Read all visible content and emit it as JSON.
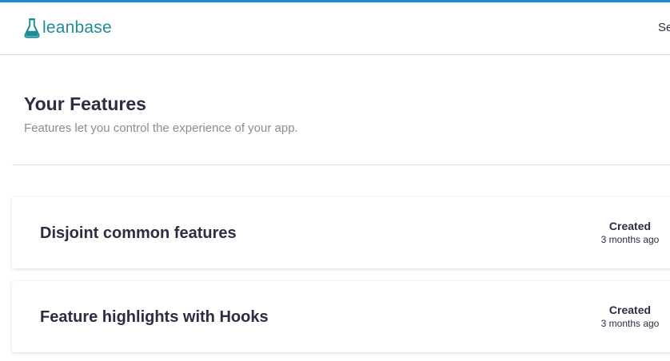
{
  "colors": {
    "accent_bar": "#1a8ad8",
    "brand": "#1f8d97",
    "text_primary": "#2b2d42",
    "text_muted": "#8a8c98"
  },
  "header": {
    "logo_icon": "flask-icon",
    "logo_text": "leanbase",
    "right_text": "Se"
  },
  "page": {
    "title": "Your Features",
    "subtitle": "Features let you control the experience of your app."
  },
  "features": [
    {
      "title": "Disjoint common features",
      "meta_label": "Created",
      "meta_value": "3 months ago"
    },
    {
      "title": "Feature highlights with Hooks",
      "meta_label": "Created",
      "meta_value": "3 months ago"
    }
  ]
}
